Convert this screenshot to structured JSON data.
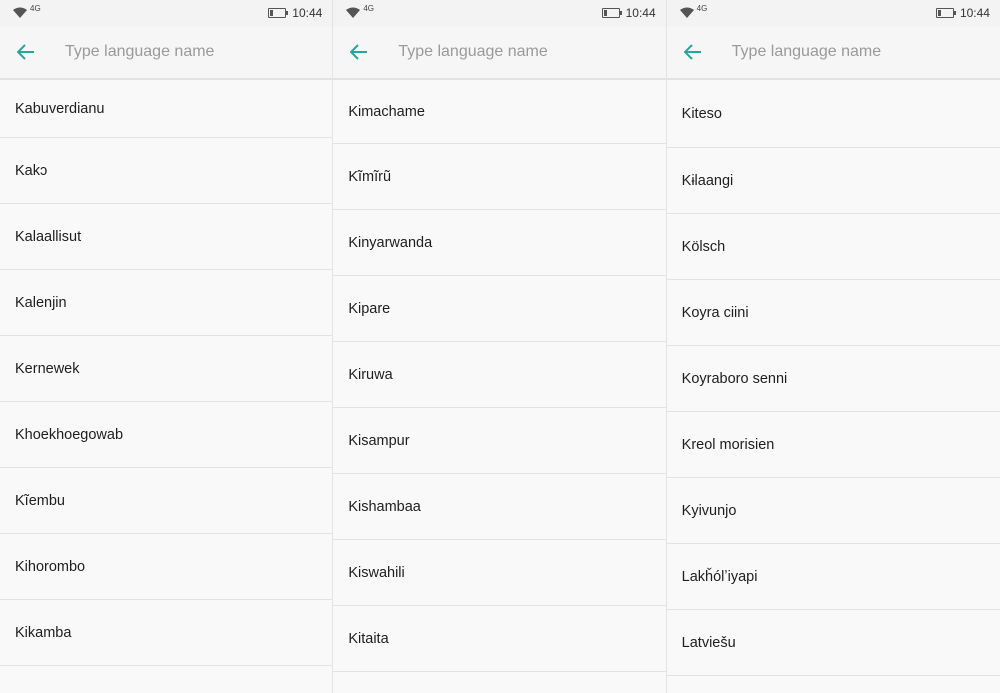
{
  "status_bar": {
    "network": "4G",
    "time": "10:44"
  },
  "search": {
    "placeholder": "Type language name"
  },
  "accent_color": "#26a69a",
  "screens": [
    {
      "languages": [
        "Kabuverdianu",
        "Kakɔ",
        "Kalaallisut",
        "Kalenjin",
        "Kernewek",
        "Khoekhoegowab",
        "Kĩembu",
        "Kihorombo",
        "Kikamba"
      ]
    },
    {
      "languages": [
        "Kimachame",
        "Kĩmĩrũ",
        "Kinyarwanda",
        "Kipare",
        "Kiruwa",
        "Kisampur",
        "Kishambaa",
        "Kiswahili",
        "Kitaita"
      ]
    },
    {
      "languages": [
        "Kiteso",
        "Kɨlaangi",
        "Kölsch",
        "Koyra ciini",
        "Koyraboro senni",
        "Kreol morisien",
        "Kyivunjo",
        "Lakȟólʼiyapi",
        "Latviešu"
      ]
    }
  ]
}
